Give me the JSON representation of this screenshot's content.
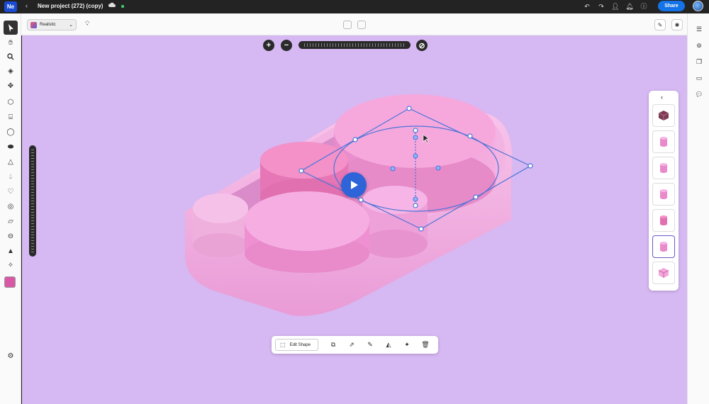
{
  "app": {
    "logo": "Ne",
    "project_title": "New project (272) (copy)",
    "share_label": "Share"
  },
  "toolbar": {
    "render_mode": "Realistic"
  },
  "action_bar": {
    "edit_shape_label": "Edit Shape"
  },
  "colors": {
    "canvas_bg": "#d6b8f2",
    "current_color": "#d958a6",
    "share_blue": "#1473e6",
    "play_blue": "#2f63d8"
  },
  "shape_panel": {
    "items": [
      {
        "icon": "cube-dark-icon"
      },
      {
        "icon": "cylinder-icon"
      },
      {
        "icon": "cylinder-icon"
      },
      {
        "icon": "cylinder-icon"
      },
      {
        "icon": "cylinder-icon"
      },
      {
        "icon": "cylinder-icon",
        "selected": true
      },
      {
        "icon": "cube-icon"
      }
    ]
  }
}
